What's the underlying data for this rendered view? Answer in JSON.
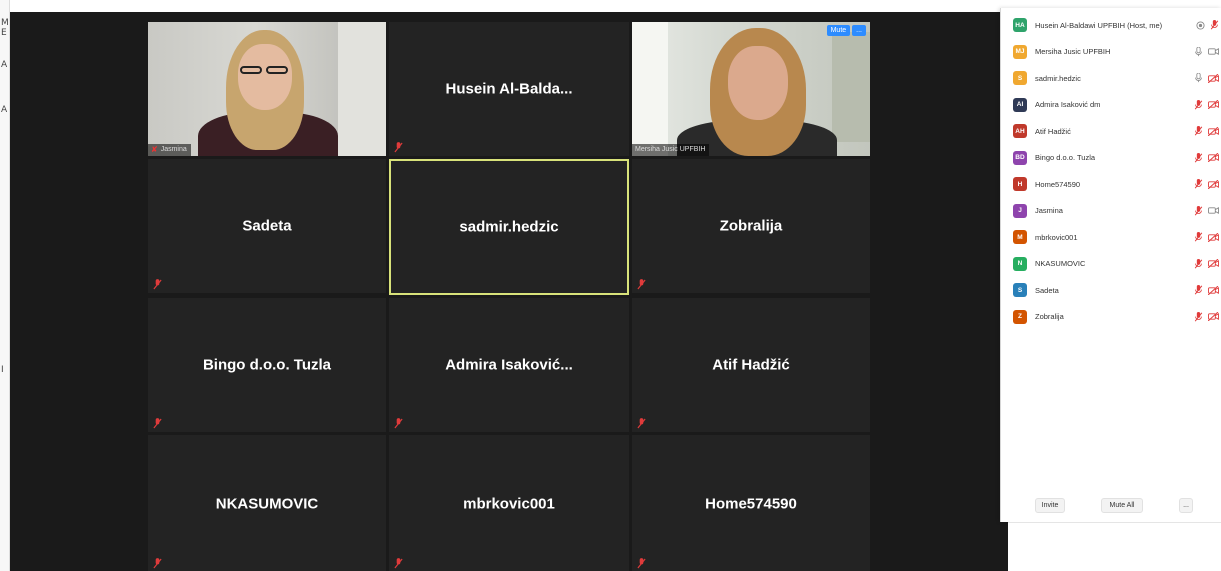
{
  "left_strip": {
    "chars": [
      "M",
      "E",
      "A",
      "A",
      "I"
    ]
  },
  "tiles": [
    {
      "name": "Jasmina",
      "type": "video",
      "muted": true
    },
    {
      "name": "Husein  Al-Balda...",
      "type": "name",
      "muted": true
    },
    {
      "name": "Mersiha Jusic UPFBIH",
      "type": "video",
      "muted": false,
      "overlay_buttons": [
        "Mute",
        "..."
      ]
    },
    {
      "name": "Sadeta",
      "type": "name",
      "muted": true
    },
    {
      "name": "sadmir.hedzic",
      "type": "name",
      "muted": false,
      "active": true
    },
    {
      "name": "Zobralija",
      "type": "name",
      "muted": true
    },
    {
      "name": "Bingo d.o.o. Tuzla",
      "type": "name",
      "muted": true
    },
    {
      "name": "Admira  Isaković...",
      "type": "name",
      "muted": true
    },
    {
      "name": "Atif Hadžić",
      "type": "name",
      "muted": true
    },
    {
      "name": "NKASUMOVIC",
      "type": "name",
      "muted": true
    },
    {
      "name": "mbrkovic001",
      "type": "name",
      "muted": true
    },
    {
      "name": "Home574590",
      "type": "name",
      "muted": true
    }
  ],
  "participants": [
    {
      "initials": "HA",
      "name": "Husein Al-Baldawi UPFBIH (Host, me)",
      "color": "#2ea36b",
      "mic": "off",
      "video": "record"
    },
    {
      "initials": "MJ",
      "name": "Mersiha Jusic UPFBIH",
      "color": "#f0a830",
      "mic": "on",
      "video": "on"
    },
    {
      "initials": "S",
      "name": "sadmir.hedzic",
      "color": "#f0a830",
      "mic": "on",
      "video": "off"
    },
    {
      "initials": "AI",
      "name": "Admira Isaković dm",
      "color": "#2f3a56",
      "mic": "off",
      "video": "off"
    },
    {
      "initials": "AH",
      "name": "Atif Hadžić",
      "color": "#c0392b",
      "mic": "off",
      "video": "off"
    },
    {
      "initials": "BD",
      "name": "Bingo d.o.o. Tuzla",
      "color": "#8e44ad",
      "mic": "off",
      "video": "off"
    },
    {
      "initials": "H",
      "name": "Home574590",
      "color": "#c0392b",
      "mic": "off",
      "video": "off"
    },
    {
      "initials": "J",
      "name": "Jasmina",
      "color": "#8e44ad",
      "mic": "off",
      "video": "on"
    },
    {
      "initials": "M",
      "name": "mbrkovic001",
      "color": "#d35400",
      "mic": "off",
      "video": "off"
    },
    {
      "initials": "N",
      "name": "NKASUMOVIC",
      "color": "#27ae60",
      "mic": "off",
      "video": "off"
    },
    {
      "initials": "S",
      "name": "Sadeta",
      "color": "#2980b9",
      "mic": "off",
      "video": "off"
    },
    {
      "initials": "Z",
      "name": "Zobralija",
      "color": "#d35400",
      "mic": "off",
      "video": "off"
    }
  ],
  "panel_footer": {
    "invite": "Invite",
    "mute_all": "Mute All",
    "more": "..."
  },
  "colors": {
    "active_border": "#d8e27a",
    "mute_red": "#e03b3b",
    "zoom_blue": "#2d8cff"
  }
}
